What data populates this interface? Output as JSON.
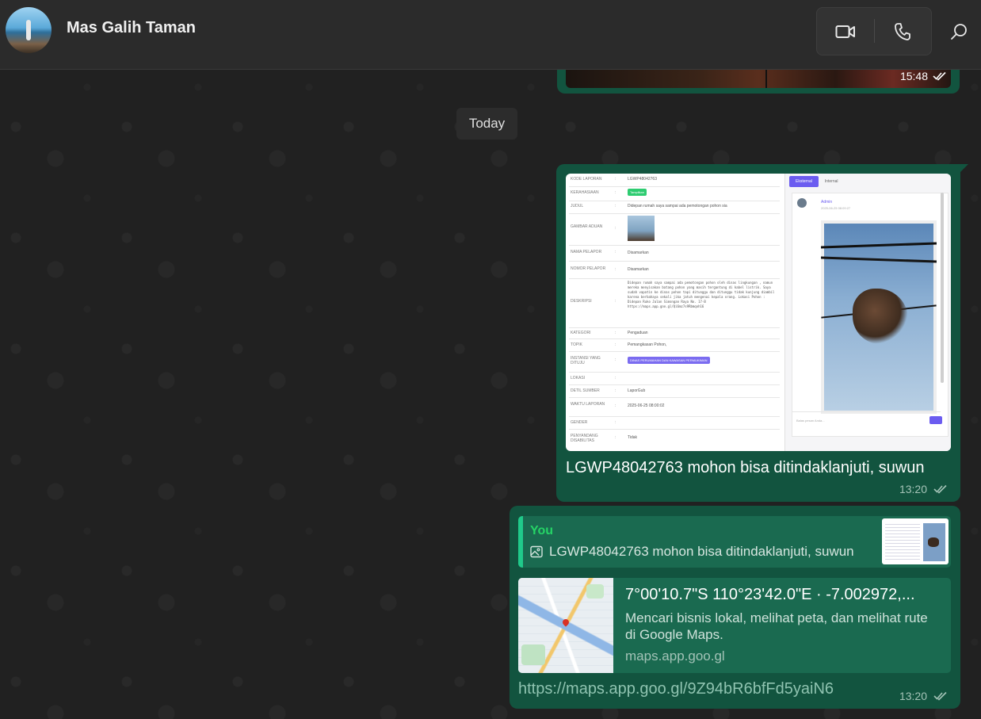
{
  "header": {
    "contact_name": "Mas Galih Taman",
    "video_icon": "video-camera-icon",
    "phone_icon": "phone-icon",
    "search_icon": "search-icon"
  },
  "messages": {
    "top": {
      "time": "15:48"
    },
    "date_separator": "Today",
    "image_message": {
      "form_rows": [
        {
          "key": "KODE LAPORAN",
          "value": "LGWP48042763"
        },
        {
          "key": "KERAHASIAAN",
          "value": "Tampilkan"
        },
        {
          "key": "JUDUL",
          "value": "Didepan rumah saya sampai ada pemotongan pohon sia"
        },
        {
          "key": "GAMBAR ADUAN",
          "value": ""
        },
        {
          "key": "NAMA PELAPOR",
          "value": "Disamarkan"
        },
        {
          "key": "NOMOR PELAPOR",
          "value": "Disamarkan"
        },
        {
          "key": "DESKRIPSI",
          "value": "Didepan rumah saya sampai ada pemotongan pohon oleh dinas lingkungan , namun mereka menyisakan batang pohon yang masih tergantung di kabel listrik. Saya sudah vapatin ke dinas pohon tapi ditunggu dan ditunggu tidak kunjung diambil karena berbahaya sekali jika jatuh mengenai kepala orang. Lokasi Pohon : Didepan Ruko Jalan Simongan Raya No. 17-B https://maps.app.goo.gl/Qi6mz7s9Rbmqoh16"
        },
        {
          "key": "KATEGORI",
          "value": "Pengaduan"
        },
        {
          "key": "TOPIK",
          "value": "Pemangkasan Pohon,"
        },
        {
          "key": "INSTANSI YANG DITUJU",
          "value": "DINAS PERUMAHAN DAN KAWASAN PERMUKIMAN"
        },
        {
          "key": "LOKASI",
          "value": ""
        },
        {
          "key": "DETIL SUMBER",
          "value": "LaporGub"
        },
        {
          "key": "WAKTU LAPORAN",
          "value": "2025-06-25 08:00:02"
        },
        {
          "key": "GENDER",
          "value": ""
        },
        {
          "key": "PENYANDANG DISABILITAS",
          "value": "Tidak"
        }
      ],
      "tabs": [
        "Eksternal",
        "Internal"
      ],
      "admin_name": "Admin",
      "admin_time": "2025-06-25 08:09:27",
      "reply_placeholder": "Balas pesan Anda...",
      "caption": "LGWP48042763 mohon bisa ditindaklanjuti, suwun",
      "time": "13:20"
    },
    "link_message": {
      "quote_author": "You",
      "quote_text": "LGWP48042763 mohon bisa ditindaklanjuti, suwun",
      "preview_title": "7°00'10.7\"S 110°23'42.0\"E · -7.002972,...",
      "preview_description": "Mencari bisnis lokal, melihat peta, dan melihat rute di Google Maps.",
      "preview_domain": "maps.app.goo.gl",
      "url": "https://maps.app.goo.gl/9Z94bR6bfFd5yaiN6",
      "time": "13:20"
    }
  },
  "colors": {
    "outgoing_bubble": "#12543f",
    "accent_green": "#25d366",
    "header_bg": "#2b2b2b"
  }
}
